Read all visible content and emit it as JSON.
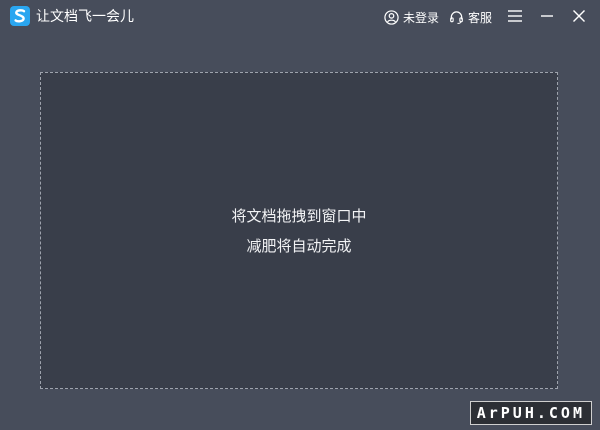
{
  "titlebar": {
    "app_icon": "app-logo-icon",
    "title": "让文档飞一会儿",
    "login_label": "未登录",
    "login_icon": "user-circle-icon",
    "service_label": "客服",
    "service_icon": "headset-icon",
    "menu_icon": "hamburger-menu-icon",
    "minimize_icon": "minimize-icon",
    "close_icon": "close-icon"
  },
  "dropzone": {
    "line1": "将文档拖拽到窗口中",
    "line2": "减肥将自动完成"
  },
  "watermark": {
    "text": "ArPUH.COM"
  },
  "colors": {
    "background": "#474d5b",
    "dropzone_bg": "#393e4a",
    "dropzone_border": "#9ea3ad",
    "logo_blue": "#2aa6f0",
    "text": "#ffffff"
  }
}
